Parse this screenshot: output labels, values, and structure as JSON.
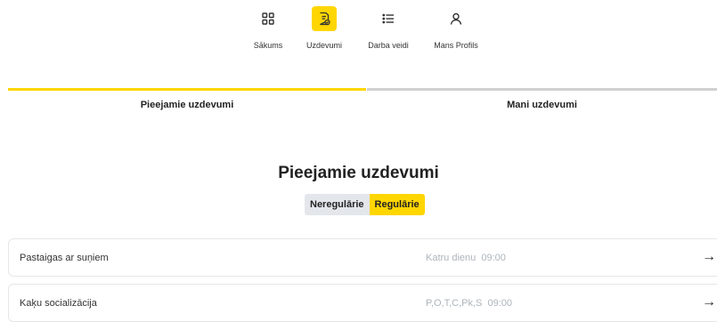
{
  "nav": {
    "items": [
      {
        "label": "Sākums",
        "icon": "grid-icon"
      },
      {
        "label": "Uzdevumi",
        "icon": "task-document-icon",
        "active": true
      },
      {
        "label": "Darba veidi",
        "icon": "list-icon"
      },
      {
        "label": "Mans Profils",
        "icon": "user-icon"
      }
    ]
  },
  "tabs": [
    {
      "label": "Pieejamie uzdevumi",
      "active": true
    },
    {
      "label": "Mani uzdevumi",
      "active": false
    }
  ],
  "main": {
    "title": "Pieejamie uzdevumi",
    "toggle": {
      "options": [
        "Neregulārie",
        "Regulārie"
      ],
      "selected": "Regulārie"
    }
  },
  "tasks": [
    {
      "name": "Pastaigas ar suņiem",
      "days": "Katru dienu",
      "time": "09:00",
      "arrow": "→"
    },
    {
      "name": "Kaķu socializācija",
      "days": "P,O,T,C,Pk,S",
      "time": "09:00",
      "arrow": "→"
    }
  ],
  "colors": {
    "accent": "#ffd600",
    "inactive_toggle": "#e3e6eb",
    "schedule_text": "#aeb4bb",
    "tab_inactive_bar": "#d0d0d0"
  }
}
